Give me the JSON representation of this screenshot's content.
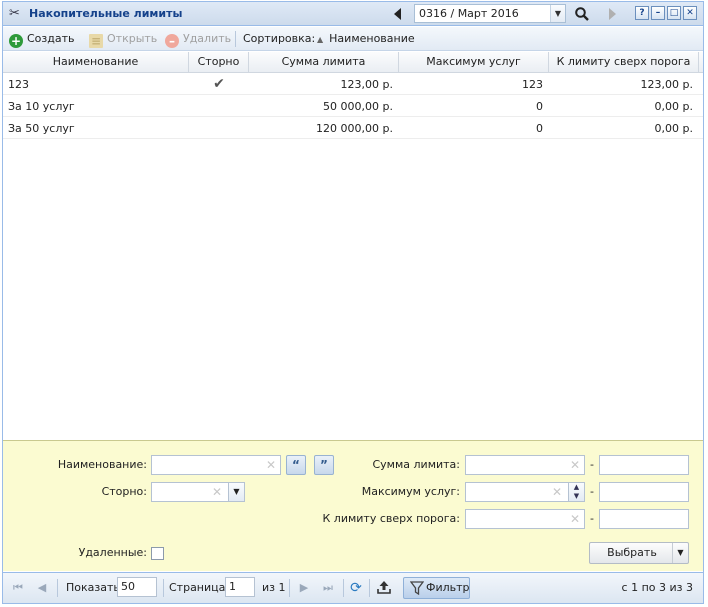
{
  "window": {
    "title": "Накопительные лимиты",
    "period": "0316 / Март 2016"
  },
  "toolbar": {
    "create_label": "Создать",
    "open_label": "Открыть",
    "delete_label": "Удалить",
    "sort_label": "Сортировка:",
    "sort_field": "Наименование"
  },
  "grid": {
    "columns": [
      "Наименование",
      "Сторно",
      "Сумма лимита",
      "Максимум услуг",
      "К лимиту сверх порога"
    ],
    "rows": [
      {
        "name": "123",
        "storno": "✔",
        "limit_sum": "123,00 р.",
        "max_services": "123",
        "over_threshold": "123,00 р."
      },
      {
        "name": "За 10 услуг",
        "storno": "",
        "limit_sum": "50 000,00 р.",
        "max_services": "0",
        "over_threshold": "0,00 р."
      },
      {
        "name": "За 50 услуг",
        "storno": "",
        "limit_sum": "120 000,00 р.",
        "max_services": "0",
        "over_threshold": "0,00 р."
      }
    ]
  },
  "filter": {
    "name_label": "Наименование:",
    "storno_label": "Сторно:",
    "limit_sum_label": "Сумма лимита:",
    "max_services_label": "Максимум услуг:",
    "over_threshold_label": "К лимиту сверх порога:",
    "deleted_label": "Удаленные:",
    "range_dash": "-",
    "select_label": "Выбрать"
  },
  "paging": {
    "show_label": "Показать",
    "page_size": "50",
    "page_label": "Страница",
    "page_value": "1",
    "of_label": "из 1",
    "filter_label": "Фильтр",
    "summary": "с 1 по 3 из 3"
  },
  "colors": {
    "filter_bg": "#fbfbd1",
    "header_blue": "#15428b",
    "create_green": "#2e9a3a",
    "delete_red": "#e07060"
  }
}
